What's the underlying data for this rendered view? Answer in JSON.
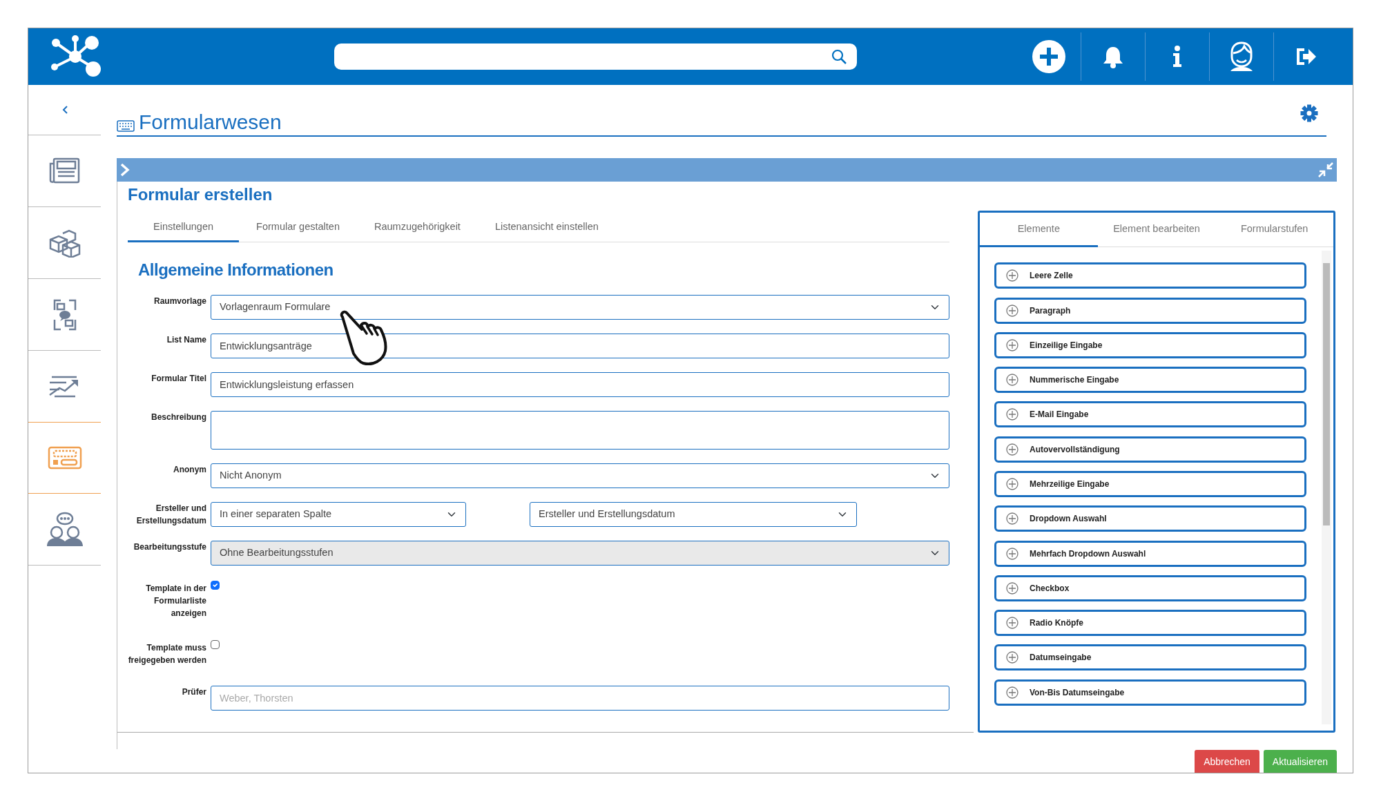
{
  "sidebar": {
    "items": [
      {
        "kind": "news",
        "selected": false
      },
      {
        "kind": "cubes",
        "selected": false
      },
      {
        "kind": "chat",
        "selected": false
      },
      {
        "kind": "chart",
        "selected": false
      },
      {
        "kind": "form",
        "selected": true
      },
      {
        "kind": "people",
        "selected": false
      }
    ]
  },
  "page_title": "Formularwesen",
  "panel": {
    "title": "Formular erstellen",
    "tabs": [
      {
        "label": "Einstellungen",
        "selected": true
      },
      {
        "label": "Formular gestalten",
        "selected": false
      },
      {
        "label": "Raumzugehörigkeit",
        "selected": false
      },
      {
        "label": "Listenansicht einstellen",
        "selected": false
      }
    ],
    "section_title": "Allgemeine Informationen",
    "fields": [
      {
        "kind": "select",
        "label": "Raumvorlage",
        "value": "Vorlagenraum Formulare",
        "disabled": false
      },
      {
        "kind": "input",
        "label": "List Name",
        "value": "Entwicklungsanträge",
        "disabled": false
      },
      {
        "kind": "input",
        "label": "Formular Titel",
        "value": "Entwicklungsleistung erfassen",
        "disabled": false
      },
      {
        "kind": "textarea",
        "label": "Beschreibung",
        "disabled": false
      },
      {
        "kind": "select",
        "label": "Anonym",
        "value": "Nicht Anonym",
        "disabled": false
      },
      {
        "kind": "select_pair",
        "label": "Ersteller und Erstellungsdatum",
        "values": [
          "In einer separaten Spalte",
          "Ersteller und Erstellungsdatum"
        ],
        "disabled": false
      },
      {
        "kind": "select",
        "label": "Bearbeitungsstufe",
        "value": "Ohne Bearbeitungsstufen",
        "disabled": true
      },
      {
        "kind": "checkbox",
        "label": "Template in der Formularliste anzeigen",
        "checked": true
      },
      {
        "kind": "checkbox",
        "label": "Template muss freigegeben werden",
        "checked": false
      },
      {
        "kind": "input",
        "label": "Prüfer",
        "placeholder": "Weber, Thorsten",
        "disabled": false
      }
    ]
  },
  "elements_panel": {
    "tabs": [
      {
        "label": "Elemente",
        "selected": true
      },
      {
        "label": "Element bearbeiten",
        "selected": false
      },
      {
        "label": "Formularstufen",
        "selected": false
      }
    ],
    "items": [
      {
        "label": "Leere Zelle"
      },
      {
        "label": "Paragraph"
      },
      {
        "label": "Einzeilige Eingabe"
      },
      {
        "label": "Nummerische Eingabe"
      },
      {
        "label": "E-Mail Eingabe"
      },
      {
        "label": "Autovervollständigung"
      },
      {
        "label": "Mehrzeilige Eingabe"
      },
      {
        "label": "Dropdown Auswahl"
      },
      {
        "label": "Mehrfach Dropdown Auswahl"
      },
      {
        "label": "Checkbox"
      },
      {
        "label": "Radio Knöpfe"
      },
      {
        "label": "Datumseingabe"
      },
      {
        "label": "Von-Bis Datumseingabe"
      }
    ]
  },
  "buttons": [
    {
      "label": "Abbrechen",
      "kind": "danger"
    },
    {
      "label": "Aktualisieren",
      "kind": "success"
    }
  ]
}
